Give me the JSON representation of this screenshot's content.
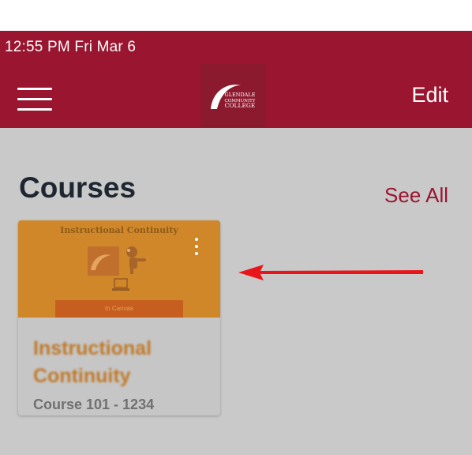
{
  "status_bar": {
    "time": "12:55 PM   Fri Mar 6"
  },
  "header": {
    "menu_icon": "hamburger-menu-icon",
    "logo_text_line1": "GLENDALE",
    "logo_text_line2": "COMMUNITY",
    "logo_text_line3": "COLLEGE",
    "edit_label": "Edit",
    "color": "#9a1530"
  },
  "courses": {
    "title": "Courses",
    "see_all_label": "See All",
    "cards": [
      {
        "image_title": "Instructional Continuity",
        "image_band_text": "In Canvas",
        "name_line1": "Instructional",
        "name_line2": "Continuity",
        "code": "Course 101 - 1234",
        "image_color": "#cf872a"
      }
    ]
  },
  "annotation": {
    "arrow_icon": "red-arrow-left-icon",
    "color": "#e8161b"
  },
  "colors": {
    "accent": "#9a1530",
    "background": "#c9c9c9",
    "title_text": "#1e2731"
  }
}
